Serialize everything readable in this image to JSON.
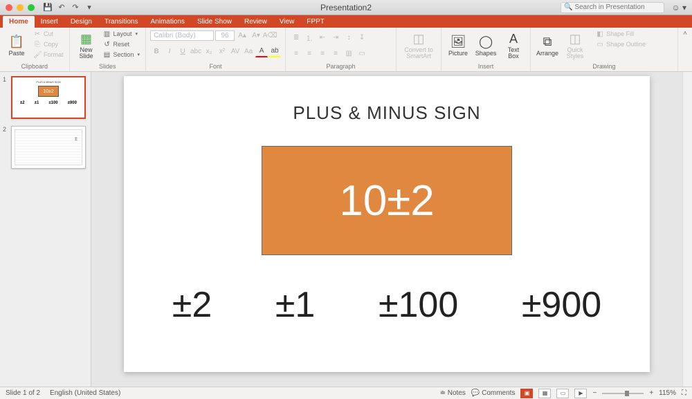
{
  "window": {
    "title": "Presentation2"
  },
  "search": {
    "placeholder": "Search in Presentation"
  },
  "tabs": {
    "home": "Home",
    "insert": "Insert",
    "design": "Design",
    "transitions": "Transitions",
    "animations": "Animations",
    "slideshow": "Slide Show",
    "review": "Review",
    "view": "View",
    "fppt": "FPPT"
  },
  "ribbon": {
    "clipboard": {
      "label": "Clipboard",
      "paste": "Paste",
      "cut": "Cut",
      "copy": "Copy",
      "format": "Format"
    },
    "slides": {
      "label": "Slides",
      "newslide": "New\nSlide",
      "layout": "Layout",
      "reset": "Reset",
      "section": "Section"
    },
    "font": {
      "label": "Font",
      "name": "Calibri (Body)",
      "size": "96"
    },
    "paragraph": {
      "label": "Paragraph"
    },
    "smartart": {
      "convert": "Convert to\nSmartArt"
    },
    "insert": {
      "label": "Insert",
      "picture": "Picture",
      "shapes": "Shapes",
      "textbox": "Text\nBox"
    },
    "format": {
      "arrange": "Arrange",
      "quick": "Quick\nStyles"
    },
    "drawing": {
      "label": "Drawing",
      "fill": "Shape Fill",
      "outline": "Shape Outline"
    }
  },
  "slide": {
    "title": "PLUS & MINUS SIGN",
    "box": "10±2",
    "v1": "±2",
    "v2": "±1",
    "v3": "±100",
    "v4": "±900"
  },
  "thumbs": {
    "n1": "1",
    "n2": "2"
  },
  "status": {
    "slide": "Slide 1 of 2",
    "lang": "English (United States)",
    "notes": "Notes",
    "comments": "Comments",
    "zoom": "115%"
  }
}
